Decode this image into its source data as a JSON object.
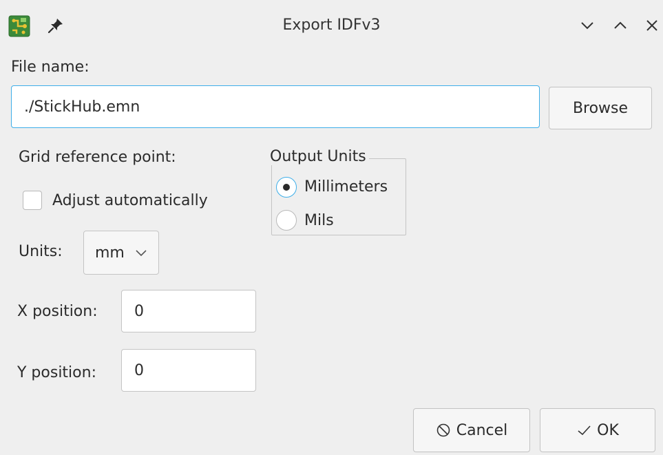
{
  "window": {
    "title": "Export IDFv3"
  },
  "file": {
    "label": "File name:",
    "value": "./StickHub.emn",
    "browse_label": "Browse"
  },
  "grid": {
    "label": "Grid reference point:",
    "adjust_label": "Adjust automatically",
    "adjust_checked": false,
    "units_label": "Units:",
    "units_value": "mm",
    "x_label": "X position:",
    "x_value": "0",
    "y_label": "Y position:",
    "y_value": "0"
  },
  "output_units": {
    "title": "Output Units",
    "options": [
      {
        "label": "Millimeters",
        "checked": true
      },
      {
        "label": "Mils",
        "checked": false
      }
    ]
  },
  "buttons": {
    "cancel_label": "Cancel",
    "ok_label": "OK"
  },
  "icons": {
    "app": "kicad-pcb-icon",
    "pin": "pin-icon",
    "minimize": "chevron-down-icon",
    "maximize": "chevron-up-icon",
    "close": "close-icon",
    "cancel": "cancel-circle-icon",
    "ok": "checkmark-icon"
  },
  "colors": {
    "accent": "#3daee9",
    "background": "#efefef"
  }
}
